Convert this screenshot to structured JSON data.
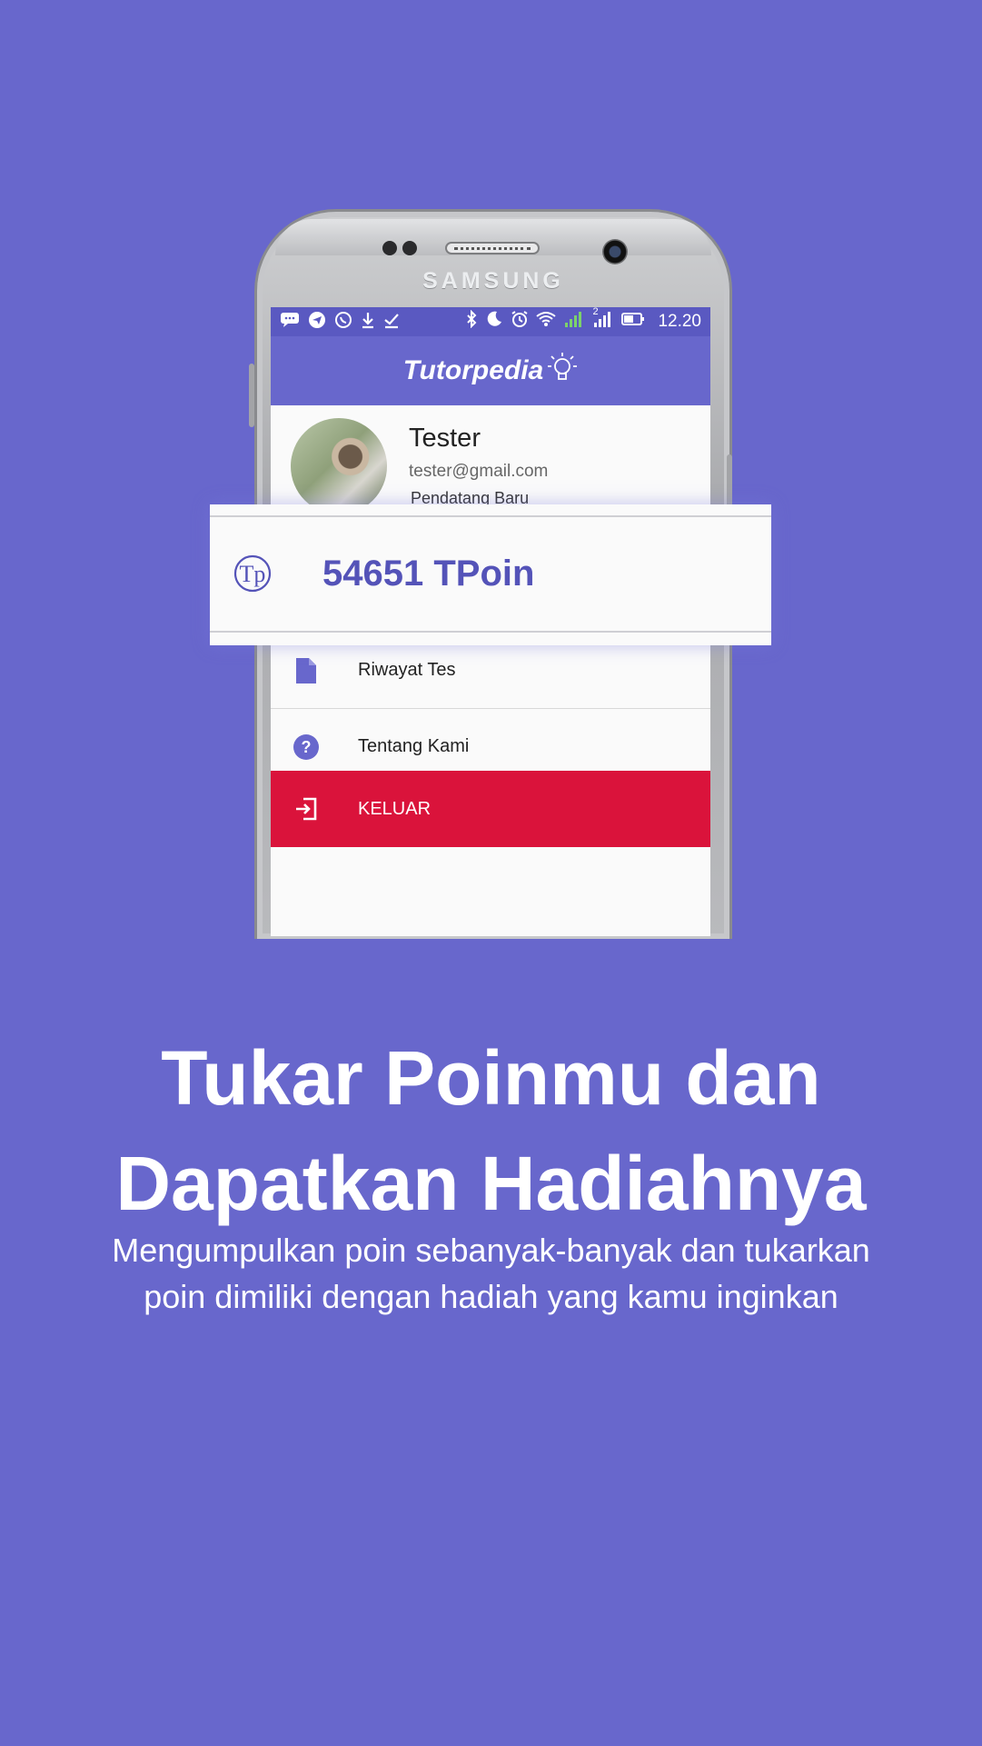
{
  "device": {
    "brand": "SAMSUNG"
  },
  "statusbar": {
    "time": "12.20",
    "sim_badge": "2"
  },
  "appbar": {
    "title": "Tutorpedia"
  },
  "profile": {
    "name": "Tester",
    "email": "tester@gmail.com",
    "rank": "Pendatang Baru"
  },
  "points": {
    "value_label": "54651 TPoin",
    "icon_text": "Tp"
  },
  "menu": {
    "items": [
      {
        "label": "Riwayat Tes",
        "icon": "document-icon"
      },
      {
        "label": "Tentang Kami",
        "icon": "help-circle-icon"
      },
      {
        "label": "KELUAR",
        "icon": "logout-icon"
      }
    ]
  },
  "promo": {
    "headline_line1": "Tukar Poinmu dan",
    "headline_line2": "Dapatkan Hadiahnya",
    "subtext_line1": "Mengumpulkan poin sebanyak-banyak dan tukarkan",
    "subtext_line2": "poin dimiliki dengan hadiah yang kamu inginkan"
  },
  "colors": {
    "background": "#6867cc",
    "primary": "#6867cc",
    "statusbar": "#5a59c1",
    "logout": "#da133b",
    "points_text": "#5453b8"
  }
}
